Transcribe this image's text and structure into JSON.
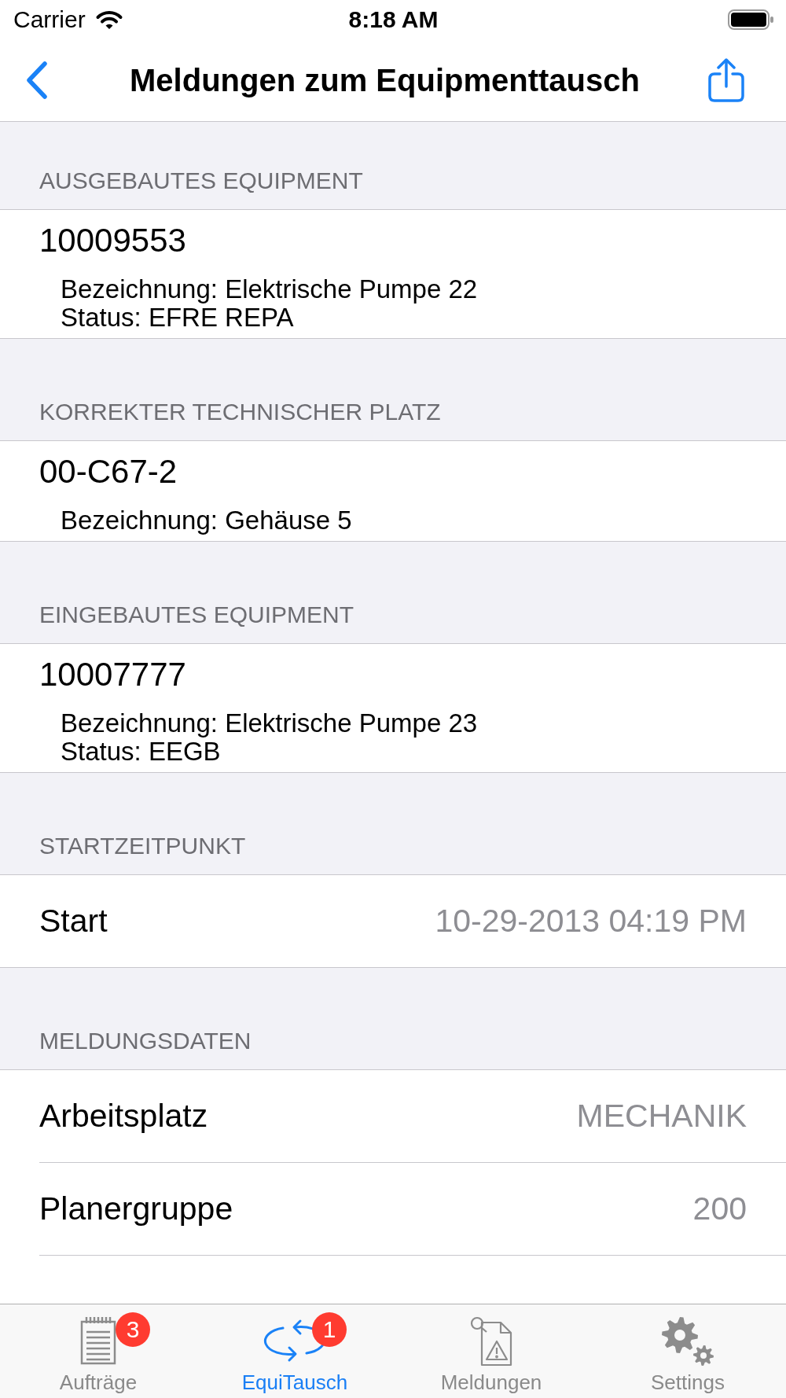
{
  "status_bar": {
    "carrier": "Carrier",
    "time": "8:18 AM"
  },
  "nav_bar": {
    "title": "Meldungen zum Equipmenttausch"
  },
  "sections": [
    {
      "header": "AUSGEBAUTES EQUIPMENT",
      "rows": [
        {
          "kind": "detail",
          "title": "10009553",
          "lines": [
            "Bezeichnung: Elektrische Pumpe 22",
            "Status: EFRE REPA"
          ]
        }
      ]
    },
    {
      "header": "KORREKTER TECHNISCHER PLATZ",
      "rows": [
        {
          "kind": "detail",
          "title": "00-C67-2",
          "lines": [
            "Bezeichnung: Gehäuse 5"
          ]
        }
      ]
    },
    {
      "header": "EINGEBAUTES EQUIPMENT",
      "rows": [
        {
          "kind": "detail",
          "title": "10007777",
          "lines": [
            "Bezeichnung: Elektrische Pumpe 23",
            "Status: EEGB"
          ]
        }
      ]
    },
    {
      "header": "STARTZEITPUNKT",
      "rows": [
        {
          "kind": "value",
          "label": "Start",
          "value": "10-29-2013 04:19 PM"
        }
      ]
    },
    {
      "header": "MELDUNGSDATEN",
      "rows": [
        {
          "kind": "value",
          "label": "Arbeitsplatz",
          "value": "MECHANIK"
        },
        {
          "kind": "value",
          "label": "Planergruppe",
          "value": "200"
        },
        {
          "kind": "value"
        }
      ]
    }
  ],
  "tab_bar": {
    "tabs": [
      {
        "label": "Aufträge",
        "badge": "3",
        "selected": false
      },
      {
        "label": "EquiTausch",
        "badge": "1",
        "selected": true
      },
      {
        "label": "Meldungen",
        "selected": false
      },
      {
        "label": "Settings",
        "selected": false
      }
    ]
  }
}
